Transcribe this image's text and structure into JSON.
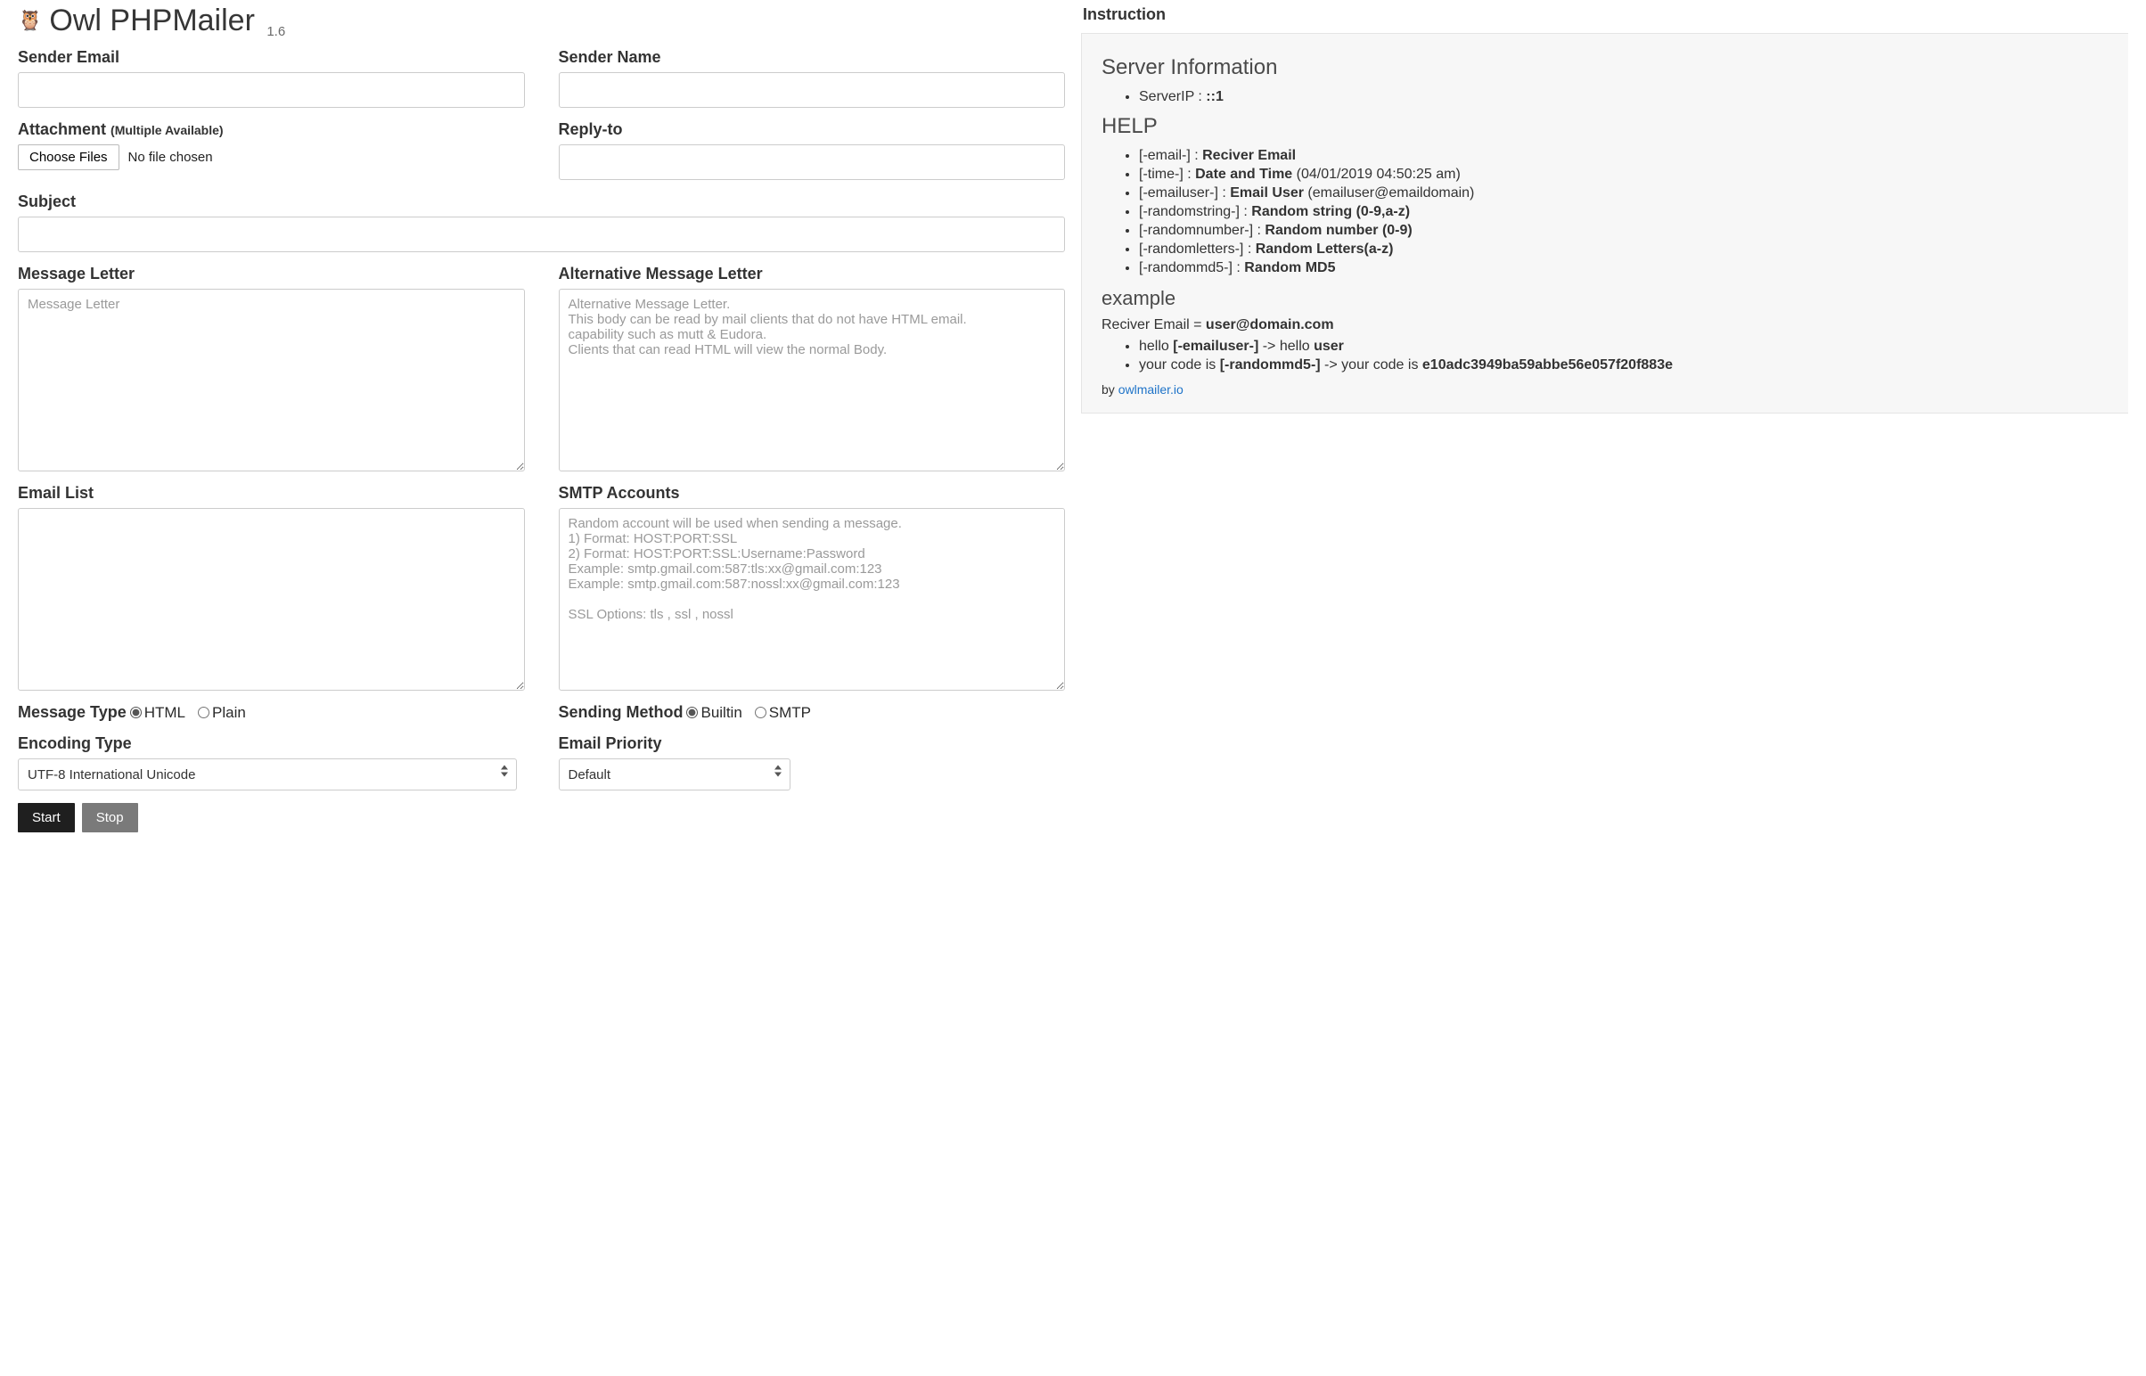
{
  "header": {
    "title": "Owl PHPMailer",
    "version": "1.6"
  },
  "form": {
    "senderEmail": {
      "label": "Sender Email",
      "value": ""
    },
    "senderName": {
      "label": "Sender Name",
      "value": ""
    },
    "attachment": {
      "label": "Attachment",
      "hint": "(Multiple Available)",
      "chooseBtn": "Choose Files",
      "status": "No file chosen"
    },
    "replyTo": {
      "label": "Reply-to",
      "value": ""
    },
    "subject": {
      "label": "Subject",
      "value": ""
    },
    "messageLetter": {
      "label": "Message Letter",
      "placeholder": "Message Letter",
      "value": ""
    },
    "altMessageLetter": {
      "label": "Alternative Message Letter",
      "placeholder": "Alternative Message Letter.\nThis body can be read by mail clients that do not have HTML email.\ncapability such as mutt & Eudora.\nClients that can read HTML will view the normal Body.",
      "value": ""
    },
    "emailList": {
      "label": "Email List",
      "value": ""
    },
    "smtpAccounts": {
      "label": "SMTP Accounts",
      "placeholder": "Random account will be used when sending a message.\n1) Format: HOST:PORT:SSL\n2) Format: HOST:PORT:SSL:Username:Password\nExample: smtp.gmail.com:587:tls:xx@gmail.com:123\nExample: smtp.gmail.com:587:nossl:xx@gmail.com:123\n\nSSL Options: tls , ssl , nossl",
      "value": ""
    },
    "messageType": {
      "label": "Message Type",
      "options": [
        "HTML",
        "Plain"
      ],
      "selected": "HTML"
    },
    "sendingMethod": {
      "label": "Sending Method",
      "options": [
        "Builtin",
        "SMTP"
      ],
      "selected": "Builtin"
    },
    "encodingType": {
      "label": "Encoding Type",
      "selected": "UTF-8 International Unicode"
    },
    "emailPriority": {
      "label": "Email Priority",
      "selected": "Default"
    },
    "startBtn": "Start",
    "stopBtn": "Stop"
  },
  "instruction": {
    "title": "Instruction",
    "serverInfoHeading": "Server Information",
    "serverIpLabel": "ServerIP :",
    "serverIpValue": "::1",
    "helpHeading": "HELP",
    "help": [
      {
        "tag": "[-email-] :",
        "bold": "Reciver Email",
        "after": ""
      },
      {
        "tag": "[-time-] :",
        "bold": "Date and Time",
        "after": " (04/01/2019 04:50:25 am)"
      },
      {
        "tag": "[-emailuser-] :",
        "bold": "Email User",
        "after": " (emailuser@emaildomain)"
      },
      {
        "tag": "[-randomstring-] :",
        "bold": "Random string (0-9,a-z)",
        "after": ""
      },
      {
        "tag": "[-randomnumber-] :",
        "bold": "Random number (0-9)",
        "after": ""
      },
      {
        "tag": "[-randomletters-] :",
        "bold": "Random Letters(a-z)",
        "after": ""
      },
      {
        "tag": "[-randommd5-] :",
        "bold": "Random MD5",
        "after": ""
      }
    ],
    "exampleHeading": "example",
    "receiverLinePrefix": "Reciver Email = ",
    "receiverLineBold": "user@domain.com",
    "examples": [
      {
        "pre": "hello ",
        "b1": "[-emailuser-]",
        "mid": " -> hello ",
        "b2": "user"
      },
      {
        "pre": "your code is ",
        "b1": "[-randommd5-]",
        "mid": " -> your code is ",
        "b2": "e10adc3949ba59abbe56e057f20f883e"
      }
    ],
    "byPrefix": "by ",
    "byLink": "owlmailer.io"
  }
}
